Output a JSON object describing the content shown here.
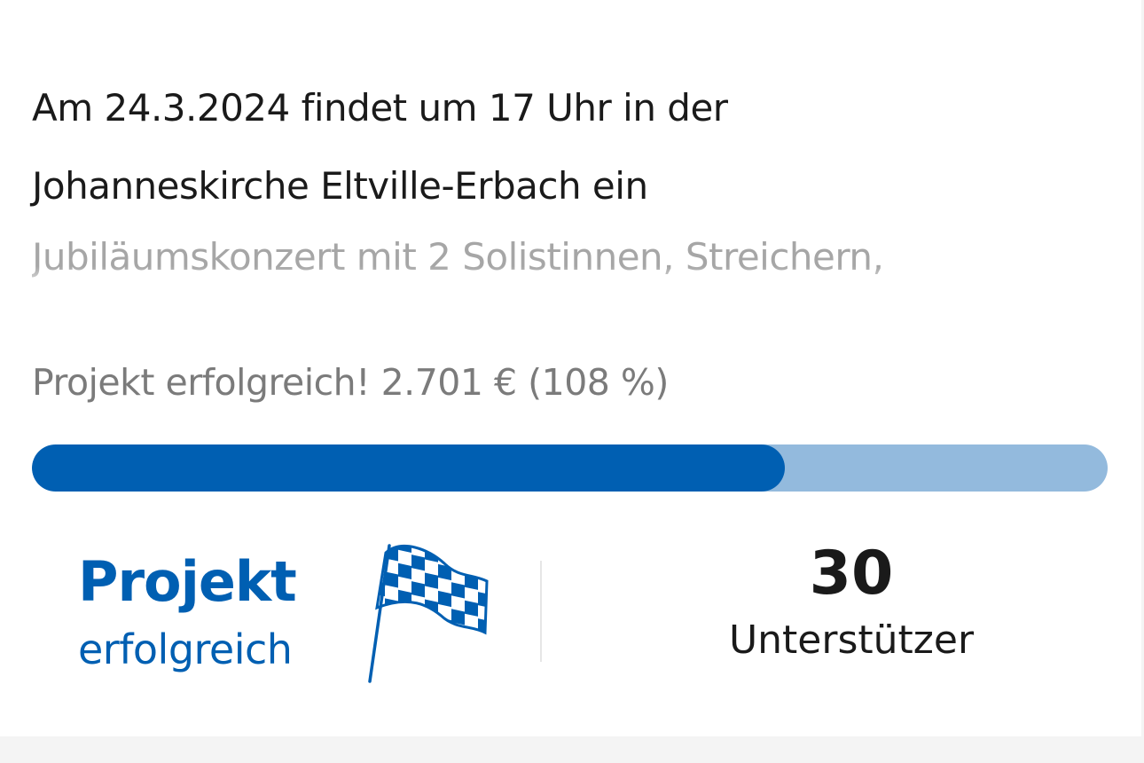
{
  "project": {
    "title": "Am 24.3.2024 findet um 17 Uhr in der Johanneskirche Eltville-Erbach ein",
    "teaser": "Jubiläumskonzert mit 2 Solistinnen, Streichern,",
    "status_text": "Projekt erfolgreich! 2.701 € (108 %)",
    "progress": {
      "fill_fraction": 0.7
    },
    "badge": {
      "title": "Projekt",
      "subtitle": "erfolgreich",
      "icon": "checkered-flag-icon"
    },
    "supporters": {
      "count": "30",
      "label": "Unterstützer"
    }
  },
  "colors": {
    "accent": "#005fb2",
    "progress_track": "#93badd",
    "text": "#1a1a1a",
    "muted_text": "#7b7b7b",
    "teaser_text": "#a6a6a6",
    "divider": "#e6e6e6"
  }
}
